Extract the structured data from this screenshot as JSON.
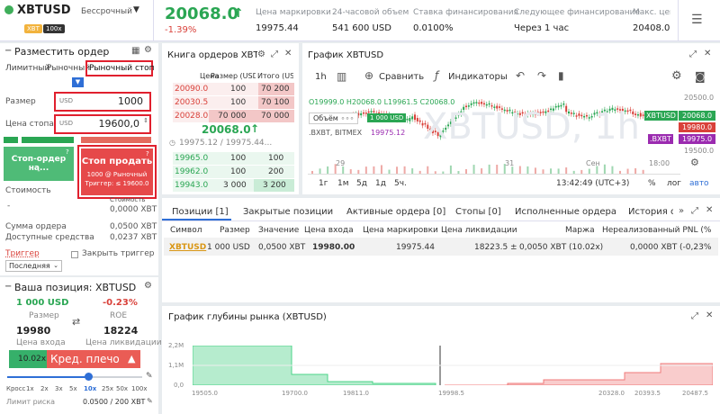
{
  "header": {
    "symbol": "XBTUSD",
    "contract_type": "Бессрочный",
    "badge_xbt": "XBT",
    "badge_lev": "100x",
    "price": "20068.0",
    "price_arrow": "↑",
    "change": "-1.39%",
    "stats": [
      {
        "label": "Цена маркировки",
        "value": "19975.44"
      },
      {
        "label": "24-часовой объем",
        "value": "541 600 USD"
      },
      {
        "label": "Ставка финансирования",
        "value": "0.0100%"
      },
      {
        "label": "Следующее финансирование",
        "value": "Через 1 час"
      },
      {
        "label": "Макс. цена",
        "value": "20408.0"
      }
    ]
  },
  "order_form": {
    "title": "Разместить ордер",
    "tabs": [
      "Лимитный",
      "Рыночный",
      "Рыночный стоп"
    ],
    "size_label": "Размер",
    "size_unit": "USD",
    "size_value": "1000",
    "stop_label": "Цена стопа",
    "stop_unit": "USD",
    "stop_value": "19600,0",
    "buy_btn": "Стоп-ордер на...",
    "buy_sub": "-",
    "sell_btn": "Стоп продать",
    "sell_line1": "1000 @ Рыночный",
    "sell_line2": "Триггер: ≤ 19600.0",
    "cost_label": "Стоимость",
    "cost_value_label": "Стоимость",
    "cost_value": "0,0000 XBT",
    "cost_dash": "-",
    "order_sum_label": "Сумма ордера",
    "order_sum_value": "0,0500 XBT",
    "avail_label": "Доступные средства",
    "avail_value": "0,0237 XBT",
    "trigger_label": "Триггер",
    "trigger_select": "Последняя",
    "close_trigger": "Закрыть триггер"
  },
  "position_box": {
    "title": "Ваша позиция: XBTUSD",
    "size": "1 000 USD",
    "roe": "-0.23%",
    "size_label": "Размер",
    "roe_label": "ROE",
    "entry": "19980",
    "liq": "18224",
    "entry_label": "Цена входа",
    "liq_label": "Цена ликвидации",
    "lev_value": "10.02x",
    "lev_label": "Кред. плечо",
    "lev_ticks": [
      "Кросс",
      "1x",
      "2x",
      "3x",
      "5x",
      "10x",
      "25x",
      "50x",
      "100x"
    ],
    "risk_label": "Лимит риска",
    "risk_value": "0.0500 / 200 XBT"
  },
  "orderbook": {
    "title": "Книга ордеров XBTU...",
    "headers": [
      "Цена",
      "Размер (USD)",
      "Итого (USD)"
    ],
    "asks": [
      {
        "price": "20090.0",
        "size": "100",
        "total": "70 200"
      },
      {
        "price": "20030.5",
        "size": "100",
        "total": "70 100"
      },
      {
        "price": "20028.0",
        "size": "70 000",
        "total": "70 000"
      }
    ],
    "last": "20068.0",
    "last_arrow": "↑",
    "mark": "19975.12 / 19975.44...",
    "bids": [
      {
        "price": "19965.0",
        "size": "100",
        "total": "100"
      },
      {
        "price": "19962.0",
        "size": "100",
        "total": "200"
      },
      {
        "price": "19943.0",
        "size": "3 000",
        "total": "3 200"
      }
    ]
  },
  "chart": {
    "title": "График XBTUSD",
    "interval": "1h",
    "compare": "Сравнить",
    "indicators": "Индикаторы",
    "ohlc": "O19999.0 H20068.0 L19961.5 C20068.0",
    "volume_label": "Объём",
    "volume_badge": "1 000 USD",
    "bxbt": ".BXBT, BITMEX",
    "bxbt_val": "19975.12",
    "y_ticks": [
      "20500.0",
      "20000.0",
      "19500.0"
    ],
    "x_ticks": [
      "29",
      "31",
      "Сен",
      "18:00"
    ],
    "price_tags": {
      "xbtusd_label": "XBTUSD",
      "xbtusd": "20068.0",
      "red": "19980.0",
      "bxbt_label": ".BXBT",
      "bxbt": "19975.0"
    },
    "periods": [
      "1г",
      "1м",
      "5д",
      "1д",
      "5ч."
    ],
    "clock": "13:42:49 (UTC+3)",
    "pct": "%",
    "log": "лог",
    "auto": "авто",
    "watermark": "XBTUSD, 1h",
    "colors": {
      "up": "#2aa653",
      "down": "#d9413a"
    }
  },
  "positions": {
    "tabs": [
      "Позиции [1]",
      "Закрытые позиции",
      "Активные ордера [0]",
      "Стопы [0]",
      "Исполненные ордера",
      "История ор"
    ],
    "headers": [
      "Символ",
      "Размер",
      "Значение",
      "Цена входа",
      "Цена маркировки",
      "Цена ликвидации",
      "Маржа",
      "Нереализованный PNL (%"
    ],
    "row": {
      "symbol": "XBTUSD",
      "size": "1 000 USD",
      "value": "0,0500 XBT",
      "entry": "19980.00",
      "mark": "19975.44",
      "liq": "18223.5",
      "margin": "0,0050 XBT (10.02x)",
      "pnl": "0,0000 XBT (-0,23%"
    }
  },
  "depth": {
    "title": "График глубины рынка (XBTUSD)",
    "y_ticks": [
      "2,2M",
      "1,1M",
      "0,0"
    ],
    "x_ticks": [
      "19505.0",
      "19700.0",
      "19811.0",
      "19998.5",
      "20328.0",
      "20393.5",
      "20487.5"
    ],
    "colors": {
      "bid": "#4cd489",
      "ask": "#f07a7a"
    }
  }
}
